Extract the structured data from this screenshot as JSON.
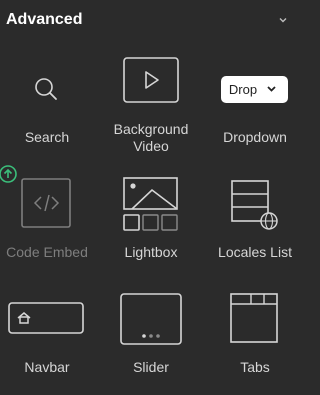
{
  "panel": {
    "title": "Advanced"
  },
  "items": [
    {
      "label": "Search",
      "icon": "search-icon"
    },
    {
      "label_line1": "Background",
      "label_line2": "Video",
      "icon": "video-play-icon"
    },
    {
      "label": "Dropdown",
      "icon": "dropdown-icon",
      "icon_text": "Drop"
    },
    {
      "label": "Code Embed",
      "icon": "code-embed-icon",
      "disabled": true
    },
    {
      "label": "Lightbox",
      "icon": "lightbox-icon"
    },
    {
      "label": "Locales List",
      "icon": "locales-list-icon"
    },
    {
      "label": "Navbar",
      "icon": "navbar-icon"
    },
    {
      "label": "Slider",
      "icon": "slider-icon"
    },
    {
      "label": "Tabs",
      "icon": "tabs-icon"
    }
  ],
  "colors": {
    "background": "#2b2b2b",
    "text": "#d6d6d6",
    "disabled_text": "#7e7e7e",
    "badge": "#3bbf7b"
  }
}
